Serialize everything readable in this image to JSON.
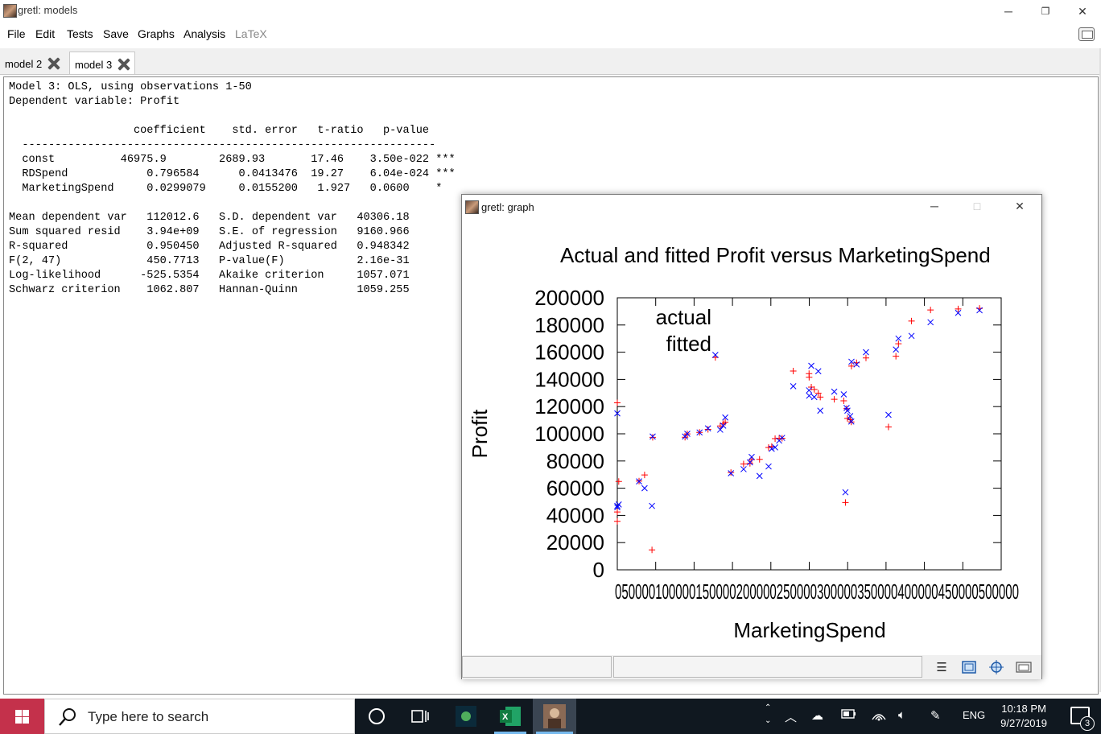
{
  "window": {
    "title": "gretl: models",
    "controls": [
      "─",
      "❐",
      "✕"
    ]
  },
  "menu": [
    "File",
    "Edit",
    "Tests",
    "Save",
    "Graphs",
    "Analysis",
    "LaTeX"
  ],
  "tabs": [
    {
      "label": "model 2",
      "active": false
    },
    {
      "label": "model 3",
      "active": true
    }
  ],
  "model_output": {
    "lines": [
      "Model 3: OLS, using observations 1-50",
      "Dependent variable: Profit",
      "",
      "                   coefficient    std. error   t-ratio   p-value",
      "  ---------------------------------------------------------------",
      "  const          46975.9        2689.93       17.46    3.50e-022 ***",
      "  RDSpend            0.796584      0.0413476  19.27    6.04e-024 ***",
      "  MarketingSpend     0.0299079     0.0155200   1.927   0.0600    *",
      "",
      "Mean dependent var   112012.6   S.D. dependent var   40306.18",
      "Sum squared resid    3.94e+09   S.E. of regression   9160.966",
      "R-squared            0.950450   Adjusted R-squared   0.948342",
      "F(2, 47)             450.7713   P-value(F)           2.16e-31",
      "Log-likelihood      -525.5354   Akaike criterion     1057.071",
      "Schwarz criterion    1062.807   Hannan-Quinn         1059.255"
    ]
  },
  "graph_window": {
    "title": "gretl: graph",
    "controls": [
      "─",
      "□",
      "✕"
    ],
    "toolbar_icons": [
      "menu-icon",
      "zoom-icon",
      "target-icon",
      "window-icon"
    ]
  },
  "chart_data": {
    "type": "scatter",
    "title": "Actual and fitted Profit versus MarketingSpend",
    "xlabel": "MarketingSpend",
    "ylabel": "Profit",
    "xlim": [
      0,
      500000
    ],
    "ylim": [
      0,
      200000
    ],
    "xticks_text": "050000100000150000200000250000300000350000400000450000500000",
    "yticks": [
      0,
      20000,
      40000,
      60000,
      80000,
      100000,
      120000,
      140000,
      160000,
      180000,
      200000
    ],
    "legend": [
      "actual",
      "fitted"
    ],
    "series": [
      {
        "name": "actual",
        "marker": "+",
        "color": "#ff0000",
        "points": [
          [
            471784,
            192262
          ],
          [
            443899,
            191792
          ],
          [
            407934,
            191050
          ],
          [
            383200,
            182902
          ],
          [
            366168,
            166188
          ],
          [
            362861,
            156991
          ],
          [
            127717,
            156123
          ],
          [
            323877,
            155753
          ],
          [
            311613,
            152212
          ],
          [
            304982,
            149760
          ],
          [
            229161,
            146122
          ],
          [
            249745,
            144259
          ],
          [
            249840,
            141586
          ],
          [
            252665,
            134307
          ],
          [
            256513,
            132602
          ],
          [
            261776,
            129917
          ],
          [
            264346,
            126993
          ],
          [
            282574,
            125371
          ],
          [
            294920,
            124267
          ],
          [
            0,
            122777
          ],
          [
            298664,
            118474
          ],
          [
            299738,
            111314
          ],
          [
            303319,
            110353
          ],
          [
            304768,
            108734
          ],
          [
            140574,
            108552
          ],
          [
            137962,
            107404
          ],
          [
            134050,
            105734
          ],
          [
            353183,
            105008
          ],
          [
            118148,
            103282
          ],
          [
            107138,
            101004
          ],
          [
            91131,
            99938
          ],
          [
            88219,
            97484
          ],
          [
            46086,
            97427
          ],
          [
            214635,
            96779
          ],
          [
            210798,
            96713
          ],
          [
            205517,
            96479
          ],
          [
            201127,
            90708
          ],
          [
            197029,
            89949
          ],
          [
            185265,
            81229
          ],
          [
            174999,
            81006
          ],
          [
            172795,
            78240
          ],
          [
            164471,
            77799
          ],
          [
            148001,
            71498
          ],
          [
            35534,
            69759
          ],
          [
            28334,
            65200
          ],
          [
            1904,
            64927
          ],
          [
            297114,
            49491
          ],
          [
            0,
            42560
          ],
          [
            0,
            35673
          ],
          [
            45173,
            14681
          ]
        ]
      },
      {
        "name": "fitted",
        "marker": "x",
        "color": "#0000ff",
        "points": [
          [
            471784,
            190800
          ],
          [
            443899,
            188900
          ],
          [
            407934,
            182000
          ],
          [
            383200,
            172000
          ],
          [
            366168,
            170000
          ],
          [
            362861,
            162000
          ],
          [
            127717,
            158000
          ],
          [
            323877,
            160000
          ],
          [
            311613,
            151000
          ],
          [
            304982,
            153000
          ],
          [
            229161,
            135000
          ],
          [
            249745,
            132000
          ],
          [
            249840,
            128000
          ],
          [
            252665,
            150000
          ],
          [
            256513,
            127000
          ],
          [
            261776,
            146000
          ],
          [
            264346,
            117000
          ],
          [
            282574,
            131000
          ],
          [
            294920,
            129000
          ],
          [
            0,
            115000
          ],
          [
            298664,
            119000
          ],
          [
            299738,
            117000
          ],
          [
            303319,
            113000
          ],
          [
            304768,
            109000
          ],
          [
            140574,
            112000
          ],
          [
            137962,
            106000
          ],
          [
            134050,
            103000
          ],
          [
            353183,
            114000
          ],
          [
            118148,
            104000
          ],
          [
            107138,
            101000
          ],
          [
            91131,
            100000
          ],
          [
            88219,
            98000
          ],
          [
            46086,
            98000
          ],
          [
            214635,
            97000
          ],
          [
            210798,
            95000
          ],
          [
            205517,
            90000
          ],
          [
            201127,
            89000
          ],
          [
            197029,
            76000
          ],
          [
            185265,
            69000
          ],
          [
            174999,
            83000
          ],
          [
            172795,
            79000
          ],
          [
            164471,
            74000
          ],
          [
            148001,
            71000
          ],
          [
            35534,
            60000
          ],
          [
            28334,
            65000
          ],
          [
            1904,
            48000
          ],
          [
            297114,
            57000
          ],
          [
            0,
            46000
          ],
          [
            0,
            47000
          ],
          [
            45173,
            47000
          ]
        ]
      }
    ]
  },
  "taskbar": {
    "search_placeholder": "Type here to search",
    "language": "ENG",
    "time": "10:18 PM",
    "date": "9/27/2019",
    "notification_count": "3"
  }
}
